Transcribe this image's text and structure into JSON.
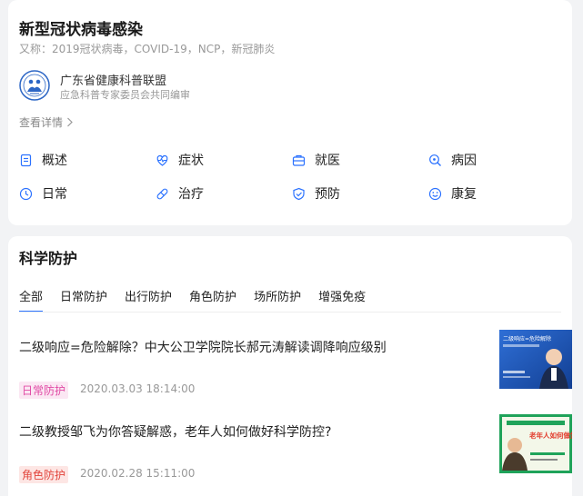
{
  "overview": {
    "title": "新型冠状病毒感染",
    "alias": "又称：2019冠状病毒，COVID-19，NCP，新冠肺炎",
    "org_name": "广东省健康科普联盟",
    "org_sub": "应急科普专家委员会共同编审",
    "more_label": "查看详情",
    "accent_color": "#2b72ff",
    "grid": [
      {
        "label": "概述",
        "icon": "document-icon"
      },
      {
        "label": "症状",
        "icon": "heart-pulse-icon"
      },
      {
        "label": "就医",
        "icon": "medical-kit-icon"
      },
      {
        "label": "病因",
        "icon": "search-icon"
      },
      {
        "label": "日常",
        "icon": "clock-icon"
      },
      {
        "label": "治疗",
        "icon": "pill-icon"
      },
      {
        "label": "预防",
        "icon": "shield-icon"
      },
      {
        "label": "康复",
        "icon": "smile-icon"
      }
    ]
  },
  "protection": {
    "title": "科学防护",
    "tabs": [
      "全部",
      "日常防护",
      "出行防护",
      "角色防护",
      "场所防护",
      "增强免疫"
    ],
    "active_tab": "全部",
    "articles": [
      {
        "title": "二级响应=危险解除？中大公卫学院院长郝元涛解读调降响应级别",
        "tag": "日常防护",
        "tag_color": "#e14aa5",
        "tag_bg": "#fbe7f3",
        "date": "2020.03.03 18:14:00",
        "thumb_caption": "二级响应=危险解除"
      },
      {
        "title": "二级教授邹飞为你答疑解惑，老年人如何做好科学防控?",
        "tag": "角色防护",
        "tag_color": "#e2453c",
        "tag_bg": "#fde6e4",
        "date": "2020.02.28 15:11:00",
        "thumb_caption": "老年人如何做好科学防控"
      }
    ]
  }
}
